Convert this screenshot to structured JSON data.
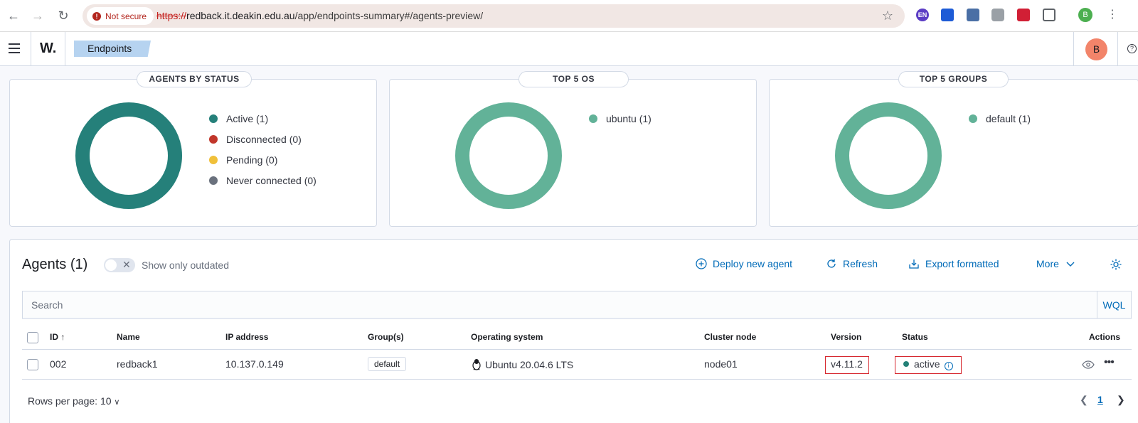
{
  "browser": {
    "security_label": "Not secure",
    "url_scheme": "https://",
    "url_host": "redback.it.deakin.edu.au",
    "url_path": "/app/endpoints-summary#/agents-preview/",
    "profile_initial": "B",
    "extensions": [
      "EN"
    ]
  },
  "app": {
    "logo": "W.",
    "breadcrumb": "Endpoints",
    "user_initial": "B"
  },
  "panels": [
    {
      "title": "AGENTS BY STATUS",
      "legend": [
        {
          "label": "Active (1)",
          "color": "#25807a"
        },
        {
          "label": "Disconnected (0)",
          "color": "#c1362a"
        },
        {
          "label": "Pending (0)",
          "color": "#f0c03a"
        },
        {
          "label": "Never connected (0)",
          "color": "#6a717d"
        }
      ],
      "ring_color": "#25807a"
    },
    {
      "title": "TOP 5 OS",
      "legend": [
        {
          "label": "ubuntu (1)",
          "color": "#62b298"
        }
      ],
      "ring_color": "#62b298"
    },
    {
      "title": "TOP 5 GROUPS",
      "legend": [
        {
          "label": "default (1)",
          "color": "#62b298"
        }
      ],
      "ring_color": "#62b298"
    }
  ],
  "agents": {
    "title": "Agents (1)",
    "toggle_label": "Show only outdated",
    "actions": {
      "deploy": "Deploy new agent",
      "refresh": "Refresh",
      "export": "Export formatted",
      "more": "More"
    },
    "search_placeholder": "Search",
    "wql": "WQL",
    "columns": {
      "id": "ID",
      "name": "Name",
      "ip": "IP address",
      "groups": "Group(s)",
      "os": "Operating system",
      "cluster": "Cluster node",
      "version": "Version",
      "status": "Status",
      "actions": "Actions"
    },
    "rows": [
      {
        "id": "002",
        "name": "redback1",
        "ip": "10.137.0.149",
        "group": "default",
        "os": "Ubuntu 20.04.6 LTS",
        "cluster": "node01",
        "version": "v4.11.2",
        "status": "active"
      }
    ],
    "rows_per_page": "Rows per page: 10",
    "current_page": "1"
  },
  "colors": {
    "accent": "#006bb8",
    "active": "#238177",
    "highlight_box": "#d6282f"
  }
}
